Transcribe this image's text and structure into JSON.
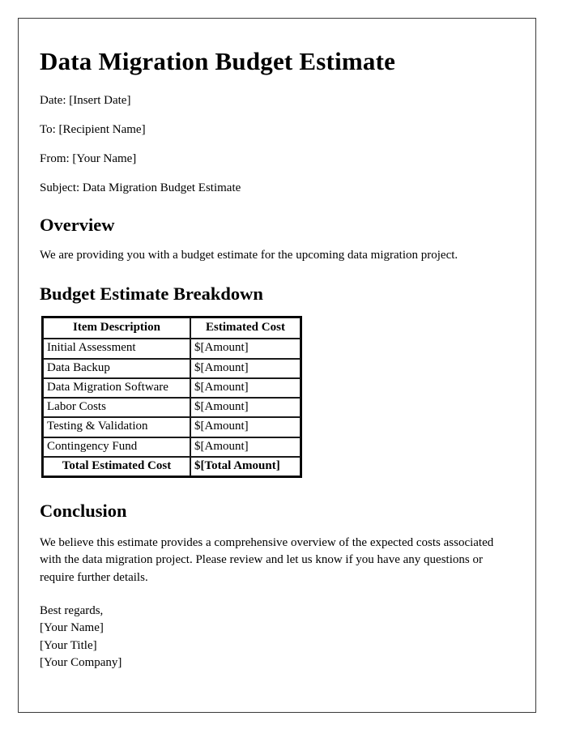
{
  "document": {
    "title": "Data Migration Budget Estimate",
    "meta": [
      {
        "name": "date-line",
        "text": "Date: [Insert Date]"
      },
      {
        "name": "to-line",
        "text": "To: [Recipient Name]"
      },
      {
        "name": "from-line",
        "text": "From: [Your Name]"
      },
      {
        "name": "subject-line",
        "text": "Subject: Data Migration Budget Estimate"
      }
    ],
    "overview": {
      "heading": "Overview",
      "paragraph": "We are providing you with a budget estimate for the upcoming data migration project."
    },
    "breakdown": {
      "heading": "Budget Estimate Breakdown",
      "table": {
        "columns": [
          "Item Description",
          "Estimated Cost"
        ],
        "rows": [
          {
            "item": "Initial Assessment",
            "cost": "$[Amount]"
          },
          {
            "item": "Data Backup",
            "cost": "$[Amount]"
          },
          {
            "item": "Data Migration Software",
            "cost": "$[Amount]"
          },
          {
            "item": "Labor Costs",
            "cost": "$[Amount]"
          },
          {
            "item": "Testing & Validation",
            "cost": "$[Amount]"
          },
          {
            "item": "Contingency Fund",
            "cost": "$[Amount]"
          }
        ],
        "total": {
          "item": "Total Estimated Cost",
          "cost": "$[Total Amount]"
        }
      }
    },
    "conclusion": {
      "heading": "Conclusion",
      "paragraph": "We believe this estimate provides a comprehensive overview of the expected costs associated with the data migration project. Please review and let us know if you have any questions or require further details."
    },
    "signature": {
      "closing": "Best regards,",
      "name": "[Your Name]",
      "title": "[Your Title]",
      "company": "[Your Company]"
    }
  },
  "colors": {
    "page_border": "#3a3a3a",
    "text": "#000000",
    "table_border": "#1a1a1a",
    "background": "#ffffff"
  }
}
